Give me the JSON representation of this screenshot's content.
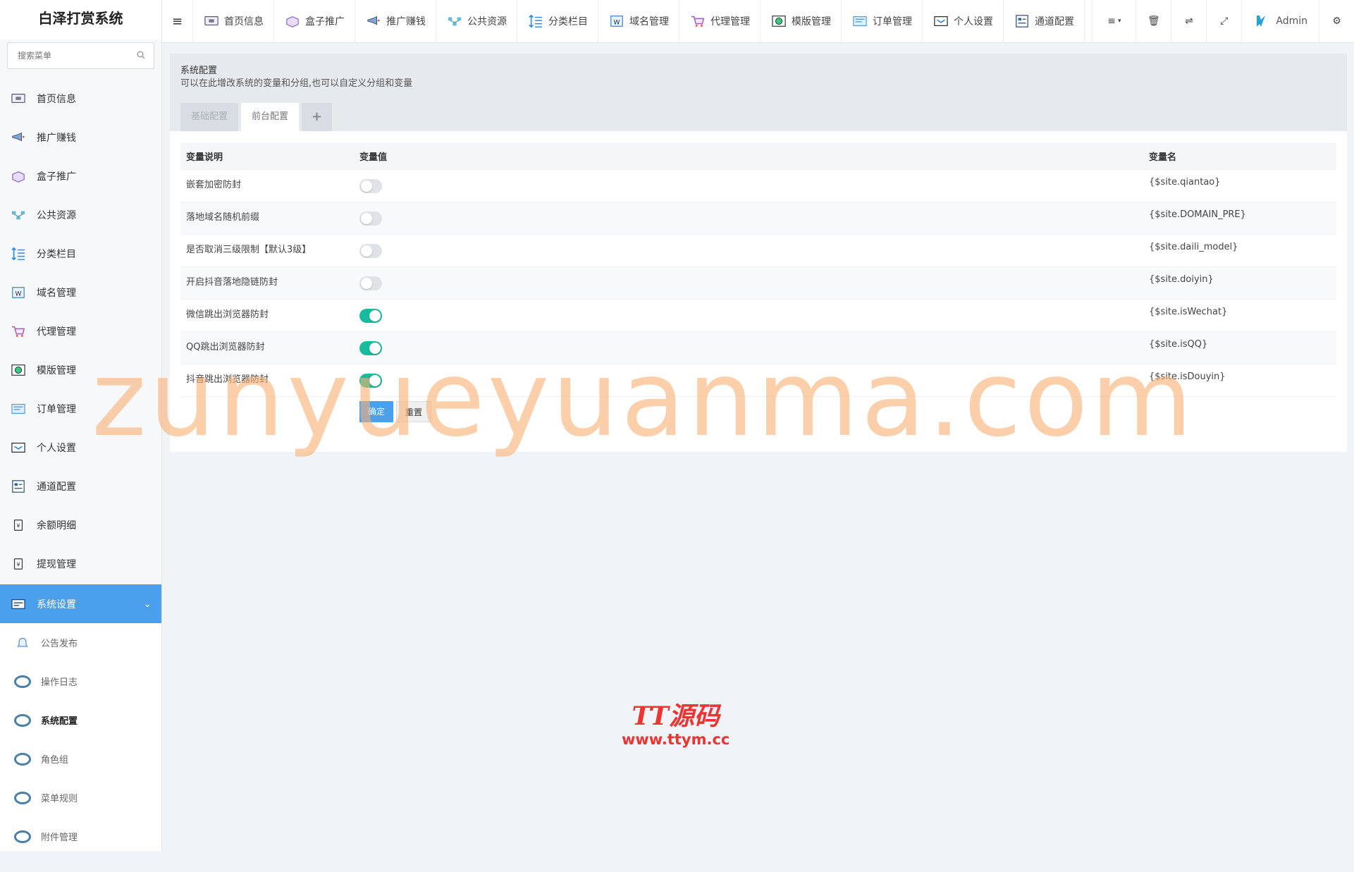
{
  "sidebar": {
    "brand": "白泽打赏系统",
    "search_placeholder": "搜索菜单",
    "items": [
      {
        "label": "首页信息",
        "icon": "computer-icon"
      },
      {
        "label": "推广赚钱",
        "icon": "megaphone-icon"
      },
      {
        "label": "盒子推广",
        "icon": "box-icon"
      },
      {
        "label": "公共资源",
        "icon": "network-icon"
      },
      {
        "label": "分类栏目",
        "icon": "sort-icon"
      },
      {
        "label": "域名管理",
        "icon": "domain-icon"
      },
      {
        "label": "代理管理",
        "icon": "cart-icon"
      },
      {
        "label": "模版管理",
        "icon": "template-icon"
      },
      {
        "label": "订单管理",
        "icon": "order-icon"
      },
      {
        "label": "个人设置",
        "icon": "profile-icon"
      },
      {
        "label": "通道配置",
        "icon": "channel-icon"
      },
      {
        "label": "余额明细",
        "icon": "balance-icon"
      },
      {
        "label": "提现管理",
        "icon": "withdraw-icon"
      }
    ],
    "active": {
      "label": "系统设置",
      "icon": "settings-icon"
    },
    "submenu": [
      {
        "label": "公告发布",
        "icon": "bell-icon"
      },
      {
        "label": "操作日志",
        "icon": "circle-icon"
      },
      {
        "label": "系统配置",
        "icon": "circle-icon"
      },
      {
        "label": "角色组",
        "icon": "circle-icon"
      },
      {
        "label": "菜单规则",
        "icon": "circle-icon"
      },
      {
        "label": "附件管理",
        "icon": "circle-icon"
      }
    ]
  },
  "topnav": {
    "tabs": [
      {
        "label": "首页信息",
        "icon": "computer-icon"
      },
      {
        "label": "盒子推广",
        "icon": "box-icon"
      },
      {
        "label": "推广赚钱",
        "icon": "megaphone-icon"
      },
      {
        "label": "公共资源",
        "icon": "network-icon"
      },
      {
        "label": "分类栏目",
        "icon": "sort-icon"
      },
      {
        "label": "域名管理",
        "icon": "domain-icon"
      },
      {
        "label": "代理管理",
        "icon": "cart-icon"
      },
      {
        "label": "模版管理",
        "icon": "template-icon"
      },
      {
        "label": "订单管理",
        "icon": "order-icon"
      },
      {
        "label": "个人设置",
        "icon": "profile-icon"
      },
      {
        "label": "通道配置",
        "icon": "channel-icon"
      }
    ],
    "user": "Admin"
  },
  "panel": {
    "title": "系统配置",
    "description": "可以在此增改系统的变量和分组,也可以自定义分组和变量",
    "tabs": [
      "基础配置",
      "前台配置"
    ],
    "add_tab": "+",
    "columns": [
      "变量说明",
      "变量值",
      "变量名"
    ],
    "rows": [
      {
        "label": "嵌套加密防封",
        "on": false,
        "name": "{$site.qiantao}"
      },
      {
        "label": "落地域名随机前缀",
        "on": false,
        "name": "{$site.DOMAIN_PRE}"
      },
      {
        "label": "是否取消三级限制【默认3级】",
        "on": false,
        "name": "{$site.daili_model}"
      },
      {
        "label": "开启抖音落地隐链防封",
        "on": false,
        "name": "{$site.doiyin}"
      },
      {
        "label": "微信跳出浏览器防封",
        "on": true,
        "name": "{$site.isWechat}"
      },
      {
        "label": "QQ跳出浏览器防封",
        "on": true,
        "name": "{$site.isQQ}"
      },
      {
        "label": "抖音跳出浏览器防封",
        "on": true,
        "name": "{$site.isDouyin}"
      }
    ],
    "confirm": "确定",
    "reset": "重置"
  },
  "watermark": "zunyueyuanma.com",
  "stamp": {
    "line1": "TT源码",
    "line2": "www.ttym.cc"
  },
  "colors": {
    "accent": "#4ba0ee",
    "switch_on": "#18bc9c",
    "switch_off": "#dfe2e6"
  }
}
